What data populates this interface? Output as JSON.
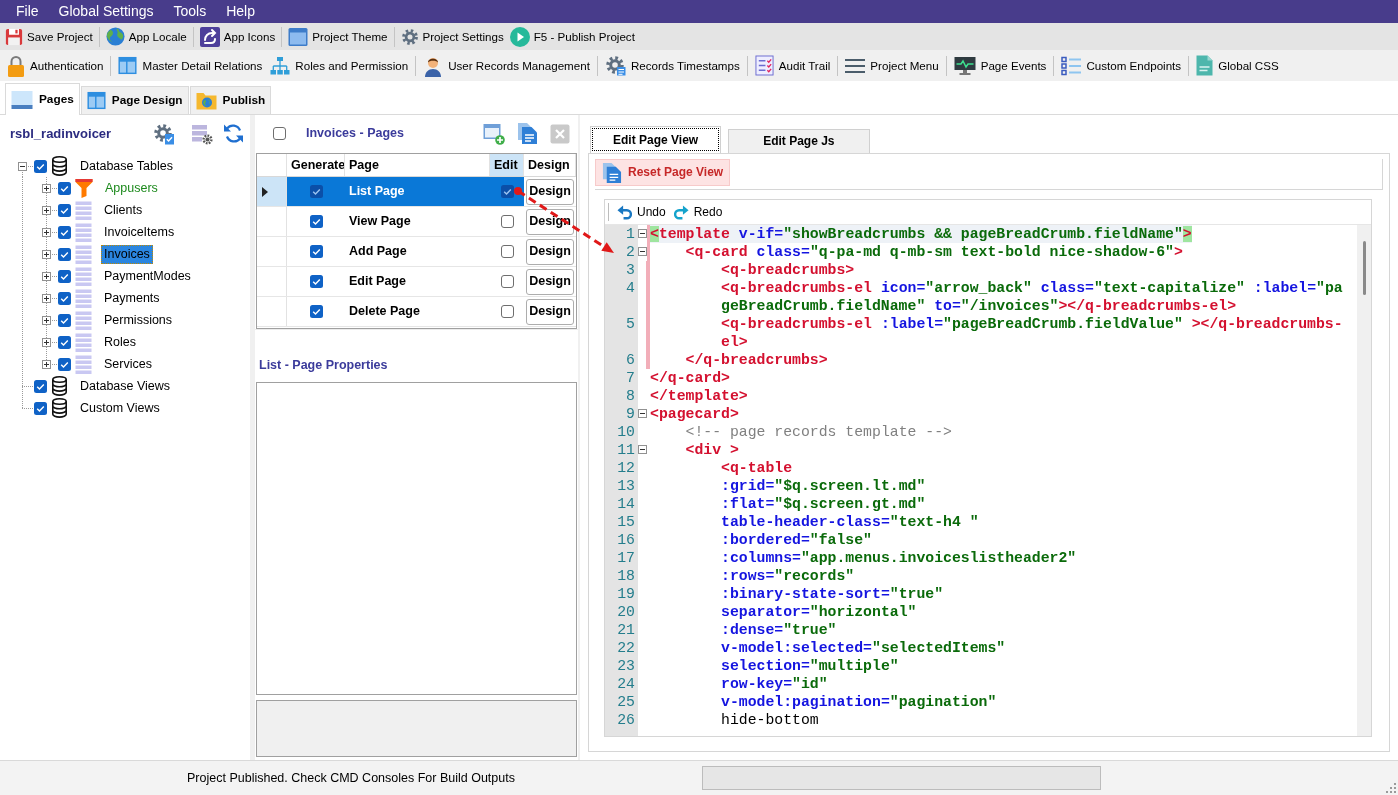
{
  "menu": [
    "File",
    "Global Settings",
    "Tools",
    "Help"
  ],
  "toolbar_main": {
    "groups": [
      [
        "Save Project"
      ],
      [
        "App Locale"
      ],
      [
        "App Icons"
      ],
      [
        "Project Theme"
      ],
      [
        "Project Settings",
        "F5 - Publish Project"
      ]
    ]
  },
  "toolbar_features": {
    "groups": [
      [
        "Authentication"
      ],
      [
        "Master Detail Relations",
        "Roles and Permission"
      ],
      [
        "User Records Management"
      ],
      [
        "Records Timestamps"
      ],
      [
        "Audit Trail"
      ],
      [
        "Project Menu"
      ],
      [
        "Page Events"
      ],
      [
        "Custom Endpoints"
      ],
      [
        "Global CSS"
      ]
    ]
  },
  "main_tabs": [
    {
      "label": "Pages",
      "selected": true
    },
    {
      "label": "Page Design",
      "selected": false
    },
    {
      "label": "Publish",
      "selected": false
    }
  ],
  "tree": {
    "title": "rsbl_radinvoicer",
    "items": [
      {
        "label": "Database Tables",
        "kind": "database",
        "checked": true,
        "expanded": true,
        "selected": false,
        "children": [
          {
            "label": "Appusers",
            "kind": "auth",
            "checked": true,
            "expanded": false,
            "selected": false
          },
          {
            "label": "Clients",
            "kind": "table",
            "checked": true,
            "expanded": false,
            "selected": false
          },
          {
            "label": "InvoiceItems",
            "kind": "table",
            "checked": true,
            "expanded": false,
            "selected": false
          },
          {
            "label": "Invoices",
            "kind": "table",
            "checked": true,
            "expanded": false,
            "selected": true
          },
          {
            "label": "PaymentModes",
            "kind": "table",
            "checked": true,
            "expanded": false,
            "selected": false
          },
          {
            "label": "Payments",
            "kind": "table",
            "checked": true,
            "expanded": false,
            "selected": false
          },
          {
            "label": "Permissions",
            "kind": "table",
            "checked": true,
            "expanded": false,
            "selected": false
          },
          {
            "label": "Roles",
            "kind": "table",
            "checked": true,
            "expanded": false,
            "selected": false
          },
          {
            "label": "Services",
            "kind": "table",
            "checked": true,
            "expanded": false,
            "selected": false
          }
        ]
      },
      {
        "label": "Database Views",
        "kind": "database",
        "checked": true,
        "selected": false
      },
      {
        "label": "Custom Views",
        "kind": "database",
        "checked": true,
        "selected": false
      }
    ]
  },
  "pages_panel": {
    "checked": false,
    "title": "Invoices - Pages",
    "actions": [
      {
        "disabled": false
      },
      {
        "disabled": false
      },
      {
        "disabled": true
      }
    ],
    "columns": [
      {
        "label": "Generate",
        "selected": false
      },
      {
        "label": "Page",
        "selected": false
      },
      {
        "label": "Edit",
        "selected": true
      },
      {
        "label": "Design",
        "selected": false
      }
    ],
    "rows": [
      {
        "page": "List Page",
        "generate": true,
        "edit": true,
        "design": "Design",
        "selected": true
      },
      {
        "page": "View Page",
        "generate": true,
        "edit": false,
        "design": "Design",
        "selected": false
      },
      {
        "page": "Add Page",
        "generate": true,
        "edit": false,
        "design": "Design",
        "selected": false
      },
      {
        "page": "Edit Page",
        "generate": true,
        "edit": false,
        "design": "Design",
        "selected": false
      },
      {
        "page": "Delete Page",
        "generate": true,
        "edit": false,
        "design": "Design",
        "selected": false
      }
    ],
    "properties_title": "List - Page Properties"
  },
  "editor": {
    "tabs": [
      {
        "label": "Edit Page View",
        "selected": true
      },
      {
        "label": "Edit Page Js",
        "selected": false
      }
    ],
    "reset_button": "Reset Page View",
    "history_buttons": [
      "Undo",
      "Redo"
    ],
    "lines": [
      {
        "number": "1",
        "fold": true,
        "changed": true,
        "current": true,
        "tokens": [
          {
            "kind": "match",
            "text": "<"
          },
          {
            "kind": "tag",
            "text": "template"
          },
          {
            "kind": "attr",
            "text": " v-if="
          },
          {
            "kind": "string",
            "text": "\"showBreadcrumbs && pageBreadCrumb.fieldName\""
          },
          {
            "kind": "match",
            "text": ">"
          }
        ]
      },
      {
        "number": "2",
        "fold": true,
        "changed": true,
        "current": false,
        "tokens": [
          {
            "kind": "tag",
            "text": "    <q-card"
          },
          {
            "kind": "attr",
            "text": " class="
          },
          {
            "kind": "string",
            "text": "\"q-pa-md q-mb-sm text-bold nice-shadow-6\""
          },
          {
            "kind": "tag",
            "text": ">"
          }
        ]
      },
      {
        "number": "3",
        "fold": false,
        "changed": true,
        "current": false,
        "tokens": [
          {
            "kind": "tag",
            "text": "        <q-breadcrumbs>"
          }
        ]
      },
      {
        "number": "4",
        "fold": false,
        "changed": true,
        "current": false,
        "tokens": [
          {
            "kind": "tag",
            "text": "        <q-breadcrumbs-el"
          },
          {
            "kind": "attr",
            "text": " icon="
          },
          {
            "kind": "string",
            "text": "\"arrow_back\""
          },
          {
            "kind": "attr",
            "text": " class="
          },
          {
            "kind": "string",
            "text": "\"text-capitalize\""
          },
          {
            "kind": "attr",
            "text": " :label="
          },
          {
            "kind": "string",
            "text": "\"pageBreadCrumb.fieldName\""
          },
          {
            "kind": "attr",
            "text": " to="
          },
          {
            "kind": "string",
            "text": "\"/invoices\""
          },
          {
            "kind": "tag",
            "text": "></q-breadcrumbs-el>"
          }
        ]
      },
      {
        "number": "5",
        "fold": false,
        "changed": true,
        "current": false,
        "tokens": [
          {
            "kind": "tag",
            "text": "        <q-breadcrumbs-el"
          },
          {
            "kind": "attr",
            "text": " :label="
          },
          {
            "kind": "string",
            "text": "\"pageBreadCrumb.fieldValue\""
          },
          {
            "kind": "tag",
            "text": " ></q-breadcrumbs-el>"
          }
        ]
      },
      {
        "number": "6",
        "fold": false,
        "changed": true,
        "current": false,
        "tokens": [
          {
            "kind": "tag",
            "text": "    </q-breadcrumbs>"
          }
        ]
      },
      {
        "number": "7",
        "fold": false,
        "changed": false,
        "current": false,
        "tokens": [
          {
            "kind": "tag",
            "text": "</q-card>"
          }
        ]
      },
      {
        "number": "8",
        "fold": false,
        "changed": false,
        "current": false,
        "tokens": [
          {
            "kind": "tag",
            "text": "</template>"
          }
        ]
      },
      {
        "number": "9",
        "fold": true,
        "changed": false,
        "current": false,
        "tokens": [
          {
            "kind": "tag",
            "text": "<pagecard>"
          }
        ]
      },
      {
        "number": "10",
        "fold": false,
        "changed": false,
        "current": false,
        "tokens": [
          {
            "kind": "comment",
            "text": "    <!-- page records template -->"
          }
        ]
      },
      {
        "number": "11",
        "fold": true,
        "changed": false,
        "current": false,
        "tokens": [
          {
            "kind": "tag",
            "text": "    <div >"
          }
        ]
      },
      {
        "number": "12",
        "fold": false,
        "changed": false,
        "current": false,
        "tokens": [
          {
            "kind": "tag",
            "text": "        <q-table"
          }
        ]
      },
      {
        "number": "13",
        "fold": false,
        "changed": false,
        "current": false,
        "tokens": [
          {
            "kind": "attr",
            "text": "        :grid="
          },
          {
            "kind": "string",
            "text": "\"$q.screen.lt.md\""
          }
        ]
      },
      {
        "number": "14",
        "fold": false,
        "changed": false,
        "current": false,
        "tokens": [
          {
            "kind": "attr",
            "text": "        :flat="
          },
          {
            "kind": "string",
            "text": "\"$q.screen.gt.md\""
          }
        ]
      },
      {
        "number": "15",
        "fold": false,
        "changed": false,
        "current": false,
        "tokens": [
          {
            "kind": "attr",
            "text": "        table-header-class="
          },
          {
            "kind": "string",
            "text": "\"text-h4 \""
          }
        ]
      },
      {
        "number": "16",
        "fold": false,
        "changed": false,
        "current": false,
        "tokens": [
          {
            "kind": "attr",
            "text": "        :bordered="
          },
          {
            "kind": "string",
            "text": "\"false\""
          }
        ]
      },
      {
        "number": "17",
        "fold": false,
        "changed": false,
        "current": false,
        "tokens": [
          {
            "kind": "attr",
            "text": "        :columns="
          },
          {
            "kind": "string",
            "text": "\"app.menus.invoiceslistheader2\""
          }
        ]
      },
      {
        "number": "18",
        "fold": false,
        "changed": false,
        "current": false,
        "tokens": [
          {
            "kind": "attr",
            "text": "        :rows="
          },
          {
            "kind": "string",
            "text": "\"records\""
          }
        ]
      },
      {
        "number": "19",
        "fold": false,
        "changed": false,
        "current": false,
        "tokens": [
          {
            "kind": "attr",
            "text": "        :binary-state-sort="
          },
          {
            "kind": "string",
            "text": "\"true\""
          }
        ]
      },
      {
        "number": "20",
        "fold": false,
        "changed": false,
        "current": false,
        "tokens": [
          {
            "kind": "attr",
            "text": "        separator="
          },
          {
            "kind": "string",
            "text": "\"horizontal\""
          }
        ]
      },
      {
        "number": "21",
        "fold": false,
        "changed": false,
        "current": false,
        "tokens": [
          {
            "kind": "attr",
            "text": "        :dense="
          },
          {
            "kind": "string",
            "text": "\"true\""
          }
        ]
      },
      {
        "number": "22",
        "fold": false,
        "changed": false,
        "current": false,
        "tokens": [
          {
            "kind": "attr",
            "text": "        v-model:selected="
          },
          {
            "kind": "string",
            "text": "\"selectedItems\""
          }
        ]
      },
      {
        "number": "23",
        "fold": false,
        "changed": false,
        "current": false,
        "tokens": [
          {
            "kind": "attr",
            "text": "        selection="
          },
          {
            "kind": "string",
            "text": "\"multiple\""
          }
        ]
      },
      {
        "number": "24",
        "fold": false,
        "changed": false,
        "current": false,
        "tokens": [
          {
            "kind": "attr",
            "text": "        row-key="
          },
          {
            "kind": "string",
            "text": "\"id\""
          }
        ]
      },
      {
        "number": "25",
        "fold": false,
        "changed": false,
        "current": false,
        "tokens": [
          {
            "kind": "attr",
            "text": "        v-model:pagination="
          },
          {
            "kind": "string",
            "text": "\"pagination\""
          }
        ]
      },
      {
        "number": "26",
        "fold": false,
        "changed": false,
        "current": false,
        "tokens": [
          {
            "kind": "plain",
            "text": "        hide-bottom"
          }
        ]
      }
    ]
  },
  "status_bar": {
    "message": "Project Published. Check CMD Consoles For Build Outputs",
    "progress": {
      "level": 0
    }
  }
}
